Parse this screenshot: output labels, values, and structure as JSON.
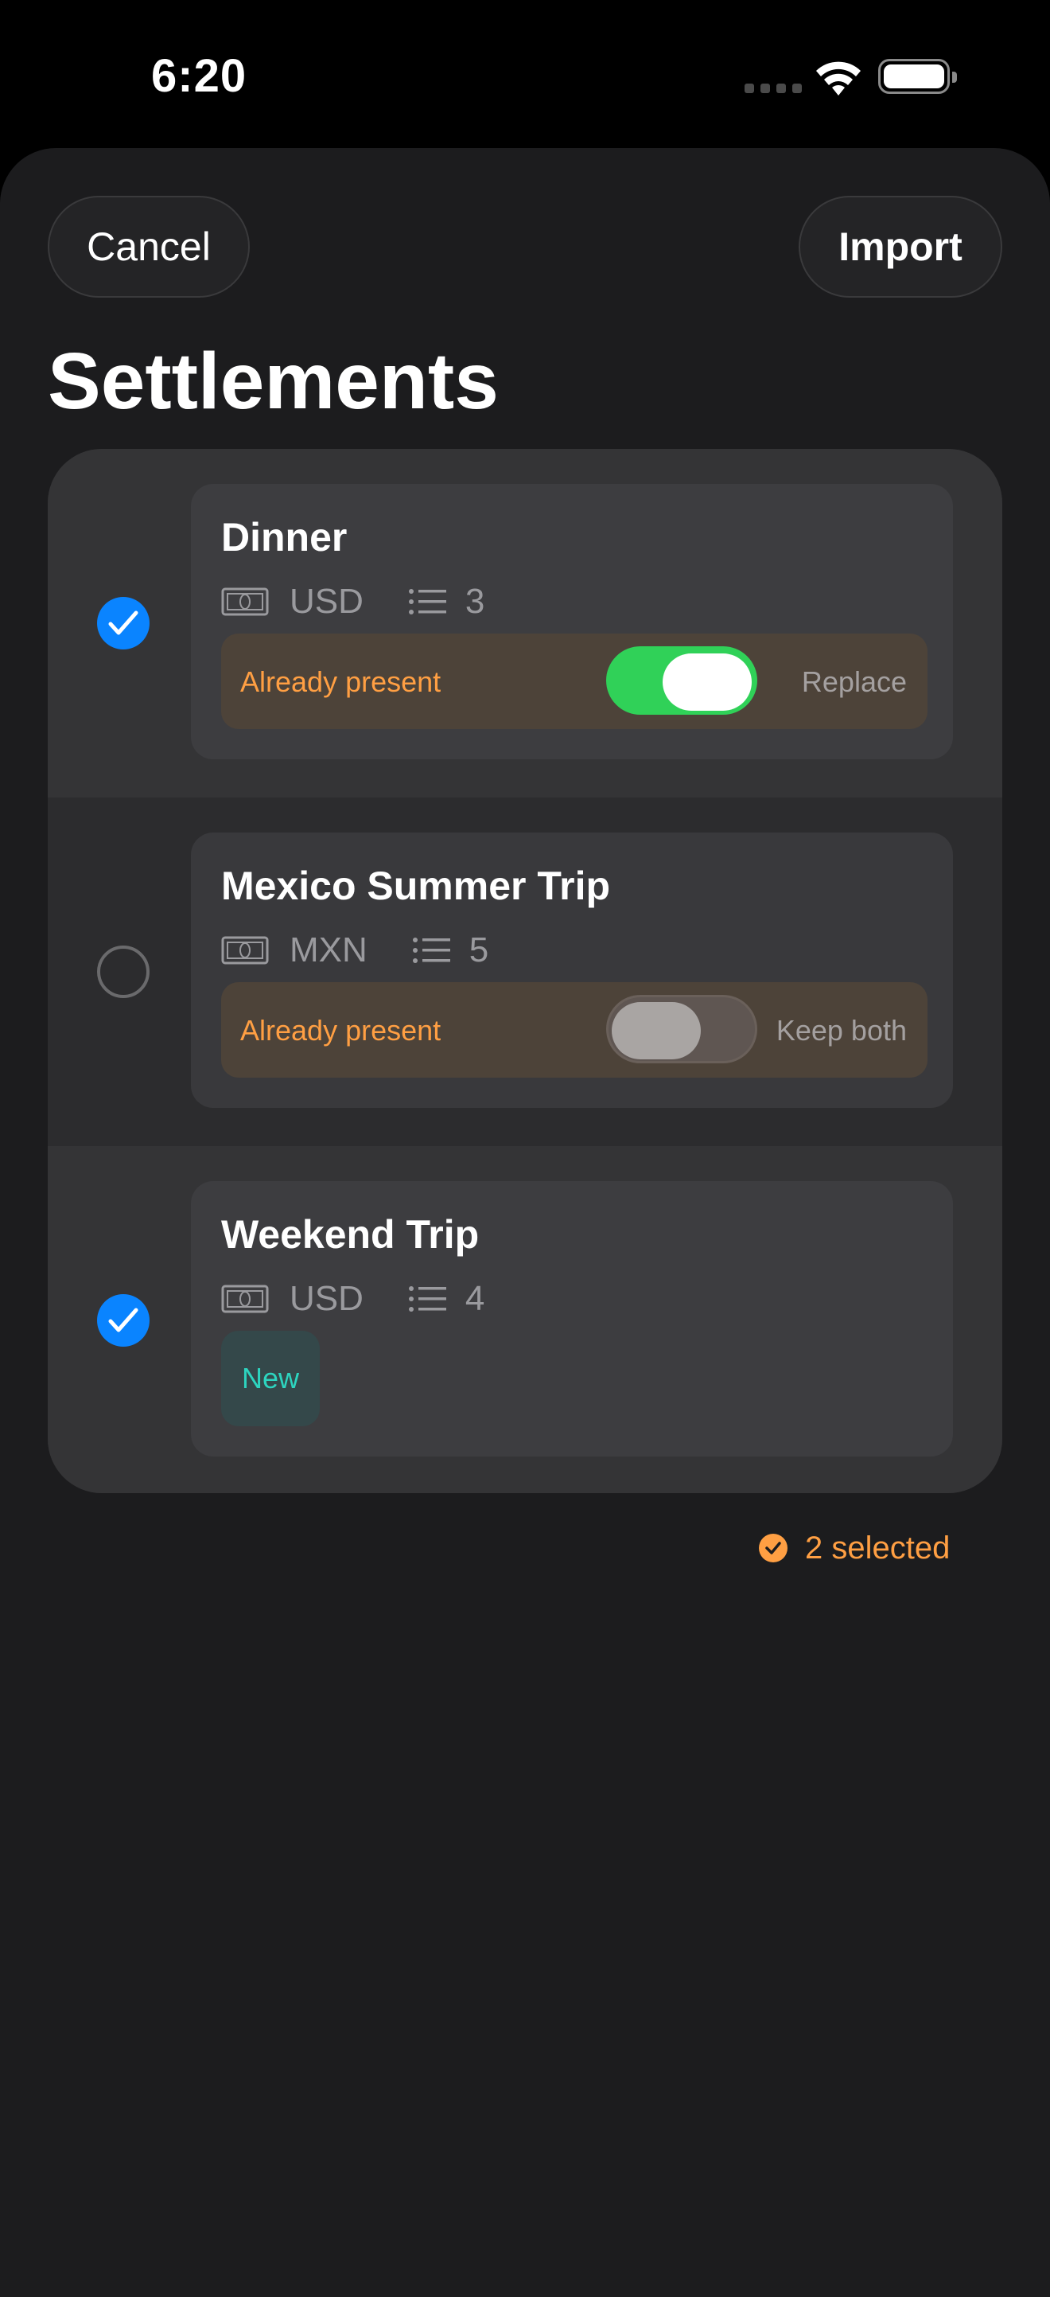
{
  "status_bar": {
    "time": "6:20"
  },
  "header": {
    "cancel_label": "Cancel",
    "import_label": "Import",
    "title": "Settlements"
  },
  "items": [
    {
      "name": "Dinner",
      "selected": true,
      "currency": "USD",
      "entry_count": "3",
      "status": "Already present",
      "toggle_on": true,
      "toggle_label": "Replace"
    },
    {
      "name": "Mexico Summer Trip",
      "selected": false,
      "currency": "MXN",
      "entry_count": "5",
      "status": "Already present",
      "toggle_on": false,
      "toggle_label": "Keep both"
    },
    {
      "name": "Weekend Trip",
      "selected": true,
      "currency": "USD",
      "entry_count": "4",
      "status": "New"
    }
  ],
  "footer": {
    "selection_summary": "2 selected"
  },
  "colors": {
    "accent_blue": "#0a84ff",
    "toggle_on": "#30d158",
    "warning_orange": "#ff9f43",
    "new_teal": "#2dd4bf"
  },
  "icons": [
    "cellular-signal-icon",
    "wifi-icon",
    "battery-icon",
    "checkmark-icon",
    "banknote-icon",
    "list-icon"
  ]
}
